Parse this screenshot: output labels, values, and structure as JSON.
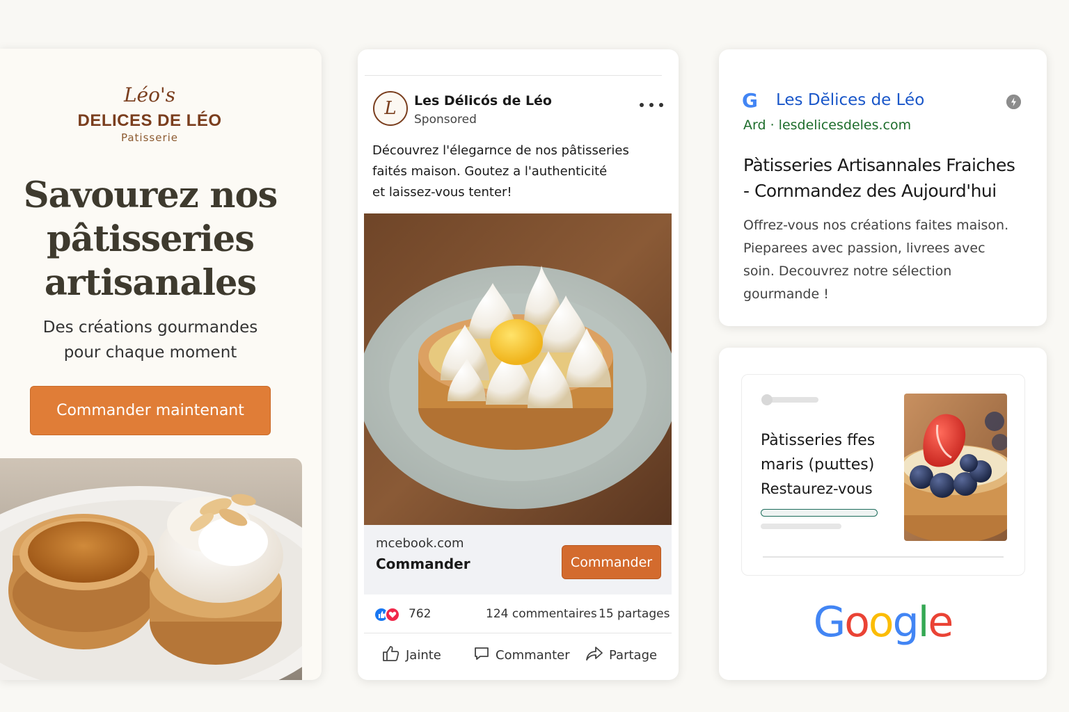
{
  "banner": {
    "logo_script": "Léo's",
    "logo_name": "DELICES DE LÉO",
    "logo_sub": "Patisserie",
    "headline": [
      "Savourez nos",
      "pâtisseries",
      "artisanales"
    ],
    "subheadline": [
      "Des créations gourmandes",
      "pour chaque moment"
    ],
    "cta_label": "Commander maintenant"
  },
  "facebook_ad": {
    "avatar_letter": "L",
    "page_name": "Les Délicós de Léo",
    "sponsored_label": "Sponsored",
    "post_text": [
      "Découvrez l'élegarnce de nos pâtisseries",
      "faités maison. Goutez a l'authenticité",
      "et laissez-vous tenter!"
    ],
    "link_domain": "mcebook.com",
    "link_title": "Commander",
    "cta_label": "Commander",
    "reactions_count": "762",
    "comments_label": "124 commentaires",
    "shares_label": "15 partages",
    "actions": {
      "like": "Jainte",
      "comment": "Commanter",
      "share": "Partage"
    }
  },
  "google_search_ad": {
    "g_letter": "G",
    "advertiser_name": "Les Dĕlices de Léo",
    "ad_label": "Ard",
    "display_url": "lesdelicesdeles.com",
    "headline": [
      "Pàtisseries Artisannales Fraiches",
      "- Cornmandez des Aujourd'hui"
    ],
    "description": [
      "Offrez-vous nos créations faites maison.",
      "Pieparees avec passion, livrees avec",
      "soin. Decouvrez notre sélection",
      "gourmande !"
    ]
  },
  "google_display_ad": {
    "title": [
      "Pàtisseries ffes",
      "maris (pɯttes)"
    ],
    "subtitle": "Restaurez-vous",
    "logo_letters": [
      {
        "char": "G",
        "color": "#4285F4"
      },
      {
        "char": "o",
        "color": "#EA4335"
      },
      {
        "char": "o",
        "color": "#FBBC05"
      },
      {
        "char": "g",
        "color": "#4285F4"
      },
      {
        "char": "l",
        "color": "#34A853"
      },
      {
        "char": "e",
        "color": "#EA4335"
      }
    ]
  },
  "colors": {
    "brand_brown": "#7a3e1e",
    "cta_orange": "#e07d37",
    "fb_cta_orange": "#d36b2e",
    "google_link_blue": "#1a57c9",
    "google_ad_green": "#1e6d2c"
  }
}
